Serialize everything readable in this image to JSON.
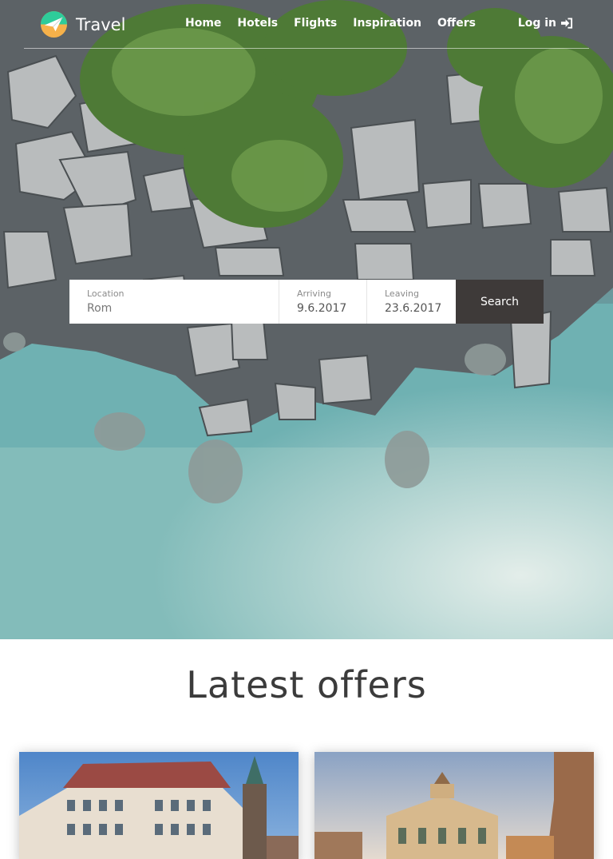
{
  "brand": {
    "name": "Travel",
    "logo_icon": "paper-plane-logo-icon"
  },
  "nav": {
    "items": [
      {
        "label": "Home"
      },
      {
        "label": "Hotels"
      },
      {
        "label": "Flights"
      },
      {
        "label": "Inspiration"
      },
      {
        "label": "Offers"
      }
    ],
    "login_label": "Log in",
    "login_icon": "sign-in-icon"
  },
  "search": {
    "location": {
      "label": "Location",
      "placeholder": "Rom"
    },
    "arriving": {
      "label": "Arriving",
      "value": "9.6.2017"
    },
    "leaving": {
      "label": "Leaving",
      "value": "23.6.2017"
    },
    "button_label": "Search"
  },
  "offers": {
    "title": "Latest offers"
  },
  "colors": {
    "logo_green": "#2ecc9a",
    "logo_orange": "#f6b14a",
    "search_button": "#3e3a39",
    "title_text": "#3b3b3b"
  }
}
